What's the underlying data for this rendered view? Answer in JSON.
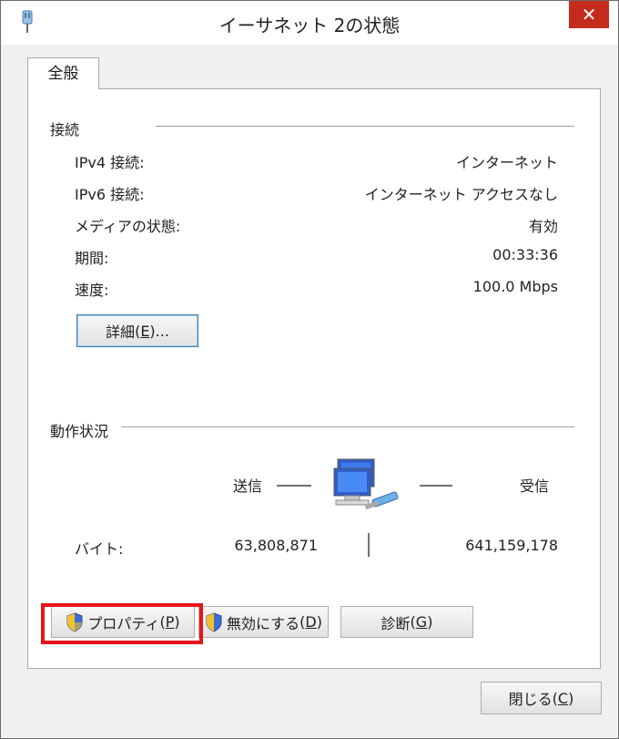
{
  "window": {
    "title": "イーサネット 2の状態",
    "close_glyph": "✕"
  },
  "tabs": [
    {
      "label": "全般"
    }
  ],
  "connection": {
    "heading": "接続",
    "rows": [
      {
        "label": "IPv4 接続:",
        "value": "インターネット"
      },
      {
        "label": "IPv6 接続:",
        "value": "インターネット アクセスなし"
      },
      {
        "label": "メディアの状態:",
        "value": "有効"
      },
      {
        "label": "期間:",
        "value": "00:33:36"
      },
      {
        "label": "速度:",
        "value": "100.0 Mbps"
      }
    ],
    "details_button": {
      "text": "詳細",
      "mnemonic": "E",
      "suffix": "..."
    }
  },
  "activity": {
    "heading": "動作状況",
    "sent_label": "送信",
    "received_label": "受信",
    "bytes_label": "バイト:",
    "bytes_sent": "63,808,871",
    "bytes_received": "641,159,178",
    "icon": "network-computers-icon"
  },
  "buttons": {
    "properties": {
      "text": "プロパティ",
      "mnemonic": "P"
    },
    "disable": {
      "text": "無効にする",
      "mnemonic": "D"
    },
    "diagnose": {
      "text": "診断",
      "mnemonic": "G"
    },
    "close": {
      "text": "閉じる",
      "mnemonic": "C"
    }
  },
  "colors": {
    "highlight": "#e8141b",
    "close_button": "#c42b1c"
  }
}
